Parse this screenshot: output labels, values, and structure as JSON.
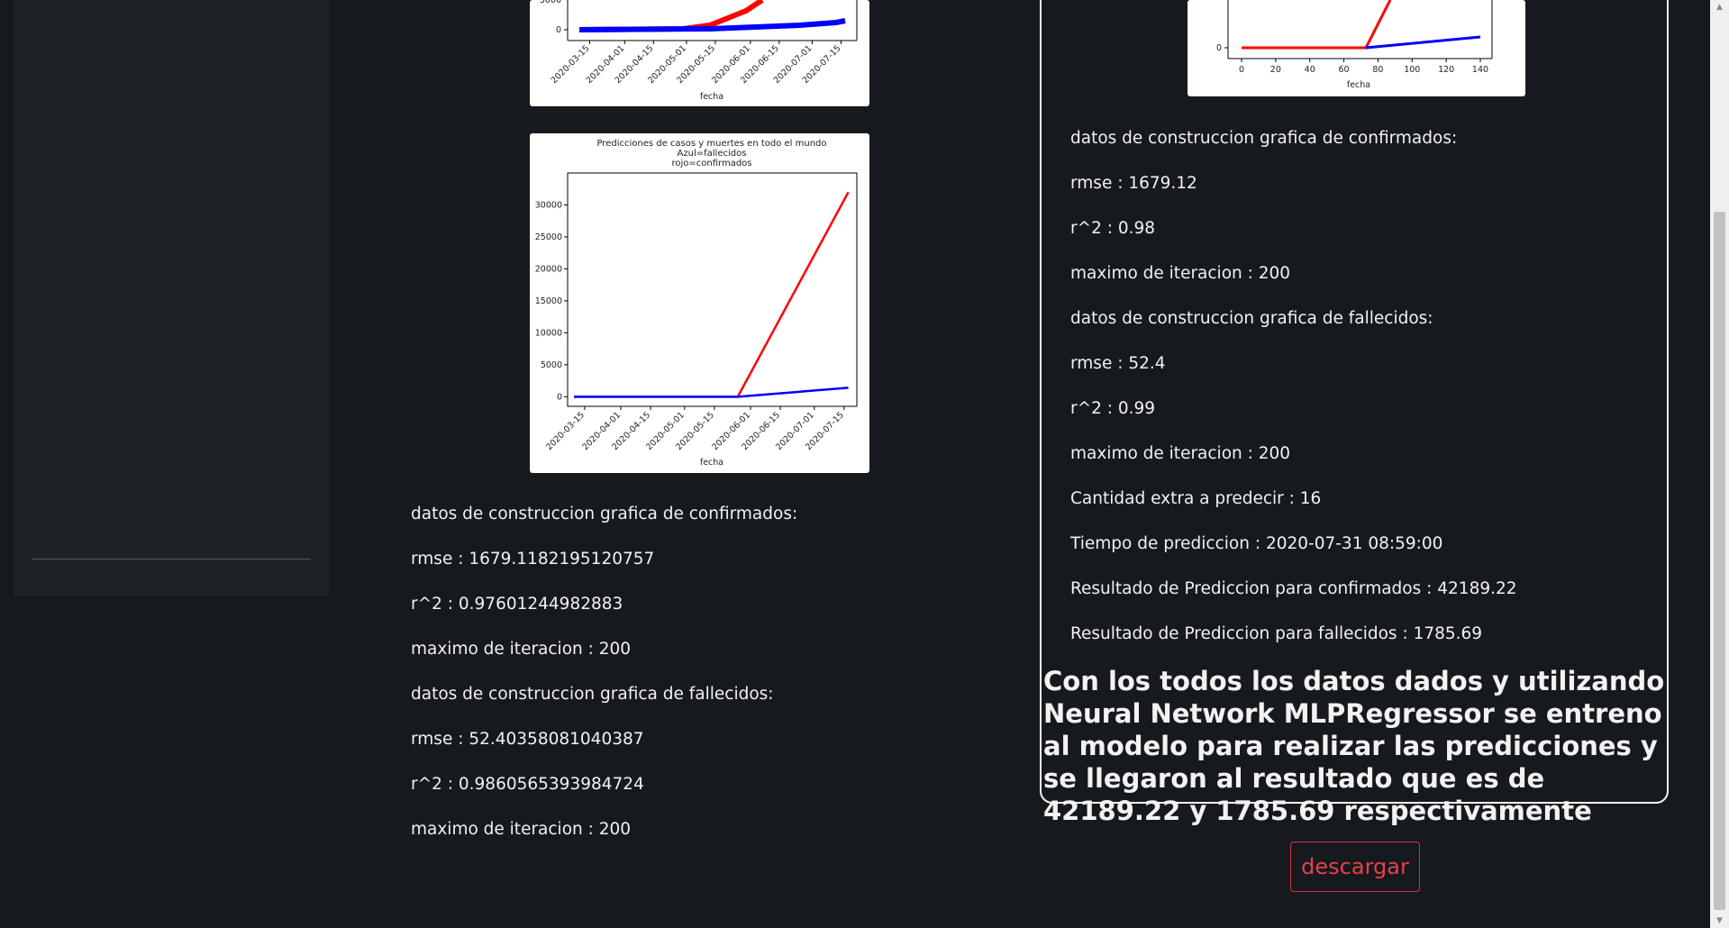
{
  "left_column": {
    "confirmed_header": "datos de construccion grafica de confirmados:",
    "confirmed_rmse": "rmse : 1679.1182195120757",
    "confirmed_r2": "r^2 : 0.97601244982883",
    "confirmed_max_iter": "maximo de iteracion : 200",
    "deaths_header": "datos de construccion grafica de fallecidos:",
    "deaths_rmse": "rmse : 52.40358081040387",
    "deaths_r2": "r^2 : 0.9860565393984724",
    "deaths_max_iter": "maximo de iteracion : 200"
  },
  "right_panel": {
    "confirmed_header": "datos de construccion grafica de confirmados:",
    "confirmed_rmse": "rmse : 1679.12",
    "confirmed_r2": "r^2 : 0.98",
    "confirmed_max_iter": "maximo de iteracion : 200",
    "deaths_header": "datos de construccion grafica de fallecidos:",
    "deaths_rmse": "rmse : 52.4",
    "deaths_r2": "r^2 : 0.99",
    "deaths_max_iter": "maximo de iteracion : 200",
    "extra_to_predict": "Cantidad extra a predecir : 16",
    "prediction_time": "Tiempo de prediccion : 2020-07-31 08:59:00",
    "result_confirmed": "Resultado de Prediccion para confirmados : 42189.22",
    "result_deaths": "Resultado de Prediccion para fallecidos : 1785.69",
    "conclusion": "Con los todos los datos dados y utilizando Neural Network MLPRegressor se entreno al modelo para realizar las predicciones y se llegaron al resultado que es de 42189.22 y 1785.69 respectivamente"
  },
  "download_button": "descargar",
  "colors": {
    "background": "#16191d",
    "sidebar": "#1e2126",
    "confirmed_series": "#ff0000",
    "deaths_series": "#0000ff",
    "button_accent": "#e5404b"
  },
  "chart_data": [
    {
      "type": "scatter",
      "title": "",
      "xlabel": "fecha",
      "x_ticks": [
        "2020-03-15",
        "2020-04-01",
        "2020-04-15",
        "2020-05-01",
        "2020-05-15",
        "2020-06-01",
        "2020-06-15",
        "2020-07-01",
        "2020-07-15"
      ],
      "y_ticks": [
        "0"
      ],
      "partially_visible": true,
      "series": []
    },
    {
      "type": "line",
      "title": "Predicciones de casos y muertes en todo el mundo",
      "subtitle_lines": [
        "Azul=fallecidos",
        "rojo=confirmados"
      ],
      "xlabel": "fecha",
      "x_ticks": [
        "2020-03-15",
        "2020-04-01",
        "2020-04-15",
        "2020-05-01",
        "2020-05-15",
        "2020-06-01",
        "2020-06-15",
        "2020-07-01",
        "2020-07-15"
      ],
      "y_ticks": [
        0,
        5000,
        10000,
        15000,
        20000,
        25000,
        30000
      ],
      "ylim": [
        -1500,
        35000
      ],
      "series": [
        {
          "color": "#ff0000",
          "x": [
            "2020-03-10",
            "2020-05-26",
            "2020-07-17"
          ],
          "values": [
            0,
            0,
            32000
          ]
        },
        {
          "color": "#0000ff",
          "x": [
            "2020-03-10",
            "2020-05-26",
            "2020-07-17"
          ],
          "values": [
            0,
            0,
            1400
          ]
        }
      ]
    },
    {
      "type": "line",
      "title": "",
      "xlabel": "fecha",
      "x_ticks": [
        0,
        20,
        40,
        60,
        80,
        100,
        120,
        140
      ],
      "y_ticks": [
        "0"
      ],
      "partially_visible": true,
      "series": []
    }
  ]
}
